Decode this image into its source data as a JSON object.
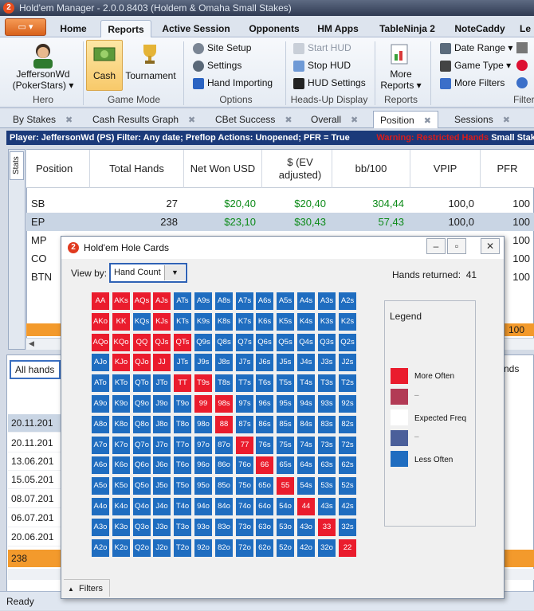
{
  "window": {
    "title": "Hold'em Manager - 2.0.0.8403 (Holdem & Omaha Small Stakes)"
  },
  "menu_tabs": [
    "Home",
    "Reports",
    "Active Session",
    "Opponents",
    "HM Apps",
    "TableNinja 2",
    "NoteCaddy",
    "Le"
  ],
  "ribbon": {
    "hero": {
      "name": "JeffersonWd",
      "site": "(PokerStars) ▾",
      "group": "Hero"
    },
    "game_mode": {
      "cash": "Cash",
      "tournament": "Tournament",
      "group": "Game Mode"
    },
    "options": {
      "site_setup": "Site Setup",
      "settings": "Settings",
      "hand_importing": "Hand Importing",
      "group": "Options"
    },
    "hud": {
      "start": "Start HUD",
      "stop": "Stop HUD",
      "settings": "HUD Settings",
      "group": "Heads-Up Display"
    },
    "reports": {
      "more": "More",
      "reports": "Reports ▾",
      "group": "Reports"
    },
    "filters": {
      "date_range": "Date Range ▾",
      "game_type": "Game Type ▾",
      "more_filters": "More Filters",
      "group": "Filter"
    }
  },
  "doc_tabs": [
    "By Stakes",
    "Cash Results Graph",
    "CBet Success",
    "Overall",
    "Position",
    "Sessions"
  ],
  "filter_bar": {
    "text": "Player: JeffersonWd (PS)   Filter: Any date; Preflop Actions: Unopened; PFR = True",
    "warning": "Warning: Restricted Hands",
    "small": "Small Stak"
  },
  "stats_tab": "Stats",
  "position_table": {
    "headers": [
      "Position",
      "Total Hands",
      "Net Won USD",
      "$ (EV adjusted)",
      "bb/100",
      "VPIP",
      "PFR"
    ],
    "rows": [
      {
        "pos": "SB",
        "hands": "27",
        "net": "$20,40",
        "ev": "$20,40",
        "bb": "304,44",
        "vpip": "100,0",
        "pfr": "100"
      },
      {
        "pos": "EP",
        "hands": "238",
        "net": "$23,10",
        "ev": "$30,43",
        "bb": "57,43",
        "vpip": "100,0",
        "pfr": "100"
      },
      {
        "pos": "MP",
        "hands": "",
        "net": "",
        "ev": "",
        "bb": "",
        "vpip": "",
        "pfr": "100"
      },
      {
        "pos": "CO",
        "hands": "",
        "net": "",
        "ev": "",
        "bb": "",
        "vpip": "",
        "pfr": "100"
      },
      {
        "pos": "BTN",
        "hands": "",
        "net": "",
        "ev": "",
        "bb": "",
        "vpip": "",
        "pfr": "100"
      }
    ],
    "total_pfr": "100"
  },
  "lower": {
    "selector": "All hands",
    "right_stub": "nds",
    "dates": [
      "20.11.201",
      "20.11.201",
      "13.06.201",
      "15.05.201",
      "08.07.201",
      "06.07.201",
      "20.06.201"
    ],
    "total": "238"
  },
  "status": "Ready",
  "popup": {
    "title": "Hold'em Hole Cards",
    "view_by_label": "View by:",
    "view_by_value": "Hand Count",
    "hands_returned_label": "Hands returned:",
    "hands_returned": "41",
    "legend": {
      "title": "Legend",
      "more": "More Often",
      "expected": "Expected Freq",
      "less": "Less Often",
      "dash1": "–",
      "dash2": "–"
    },
    "filters_label": "Filters",
    "ranks": [
      "A",
      "K",
      "Q",
      "J",
      "T",
      "9",
      "8",
      "7",
      "6",
      "5",
      "4",
      "3",
      "2"
    ],
    "red_hands": [
      "AA",
      "AKs",
      "AQs",
      "AJs",
      "AKo",
      "KK",
      "KJs",
      "AQo",
      "KQo",
      "QQ",
      "QJs",
      "QTs",
      "KJo",
      "QJo",
      "JJ",
      "TT",
      "T9s",
      "99",
      "98s",
      "88",
      "77",
      "66",
      "55",
      "44",
      "33",
      "22"
    ],
    "colors": {
      "more": "#ea1c2d",
      "more_mid": "#b23a55",
      "expected": "#ffffff",
      "less_mid": "#4b5f9a",
      "less": "#1f6dc0"
    }
  }
}
